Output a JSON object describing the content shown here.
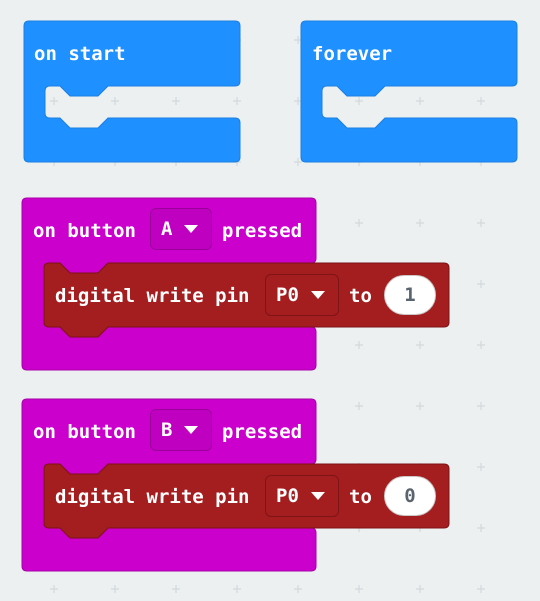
{
  "blocks": {
    "on_start": {
      "label": "on start"
    },
    "forever": {
      "label": "forever"
    },
    "button_a": {
      "prefix": "on button",
      "button": "A",
      "suffix": "pressed",
      "statement": {
        "label": "digital write pin",
        "pin": "P0",
        "to": "to",
        "value": "1"
      }
    },
    "button_b": {
      "prefix": "on button",
      "button": "B",
      "suffix": "pressed",
      "statement": {
        "label": "digital write pin",
        "pin": "P0",
        "to": "to",
        "value": "0"
      }
    }
  },
  "colors": {
    "workspace_bg": "#ecf0f1",
    "basic_block": "#1e90ff",
    "input_block": "#cc00cc",
    "pins_block": "#a41d1f"
  }
}
